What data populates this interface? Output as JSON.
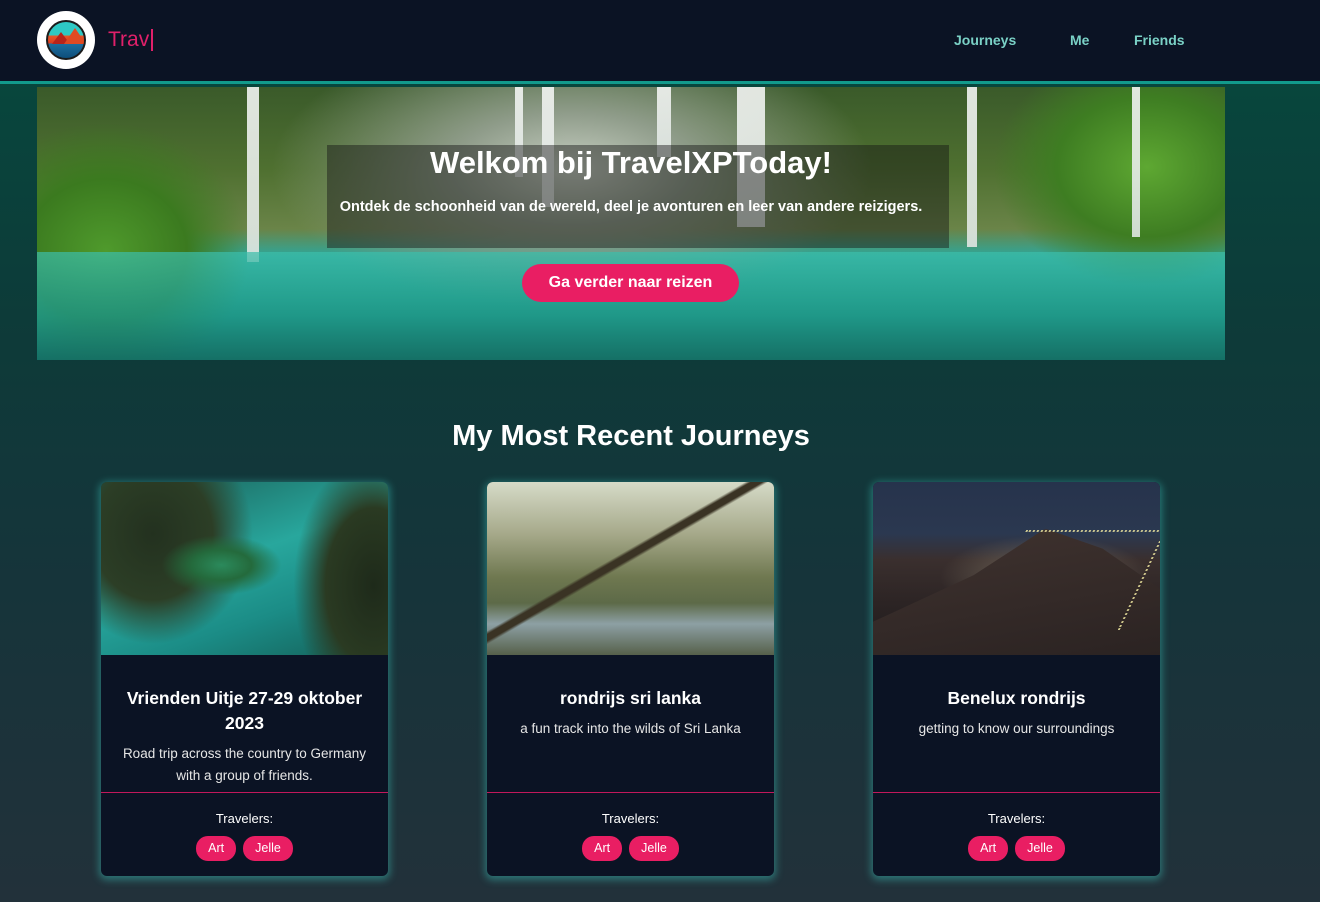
{
  "nav": {
    "brand": "Trav",
    "links": [
      "Journeys",
      "Me",
      "Friends"
    ]
  },
  "hero": {
    "title": "Welkom bij TravelXPToday!",
    "subtitle": "Ontdek de schoonheid van de wereld, deel je avonturen en leer van andere reizigers.",
    "button": "Ga verder naar reizen"
  },
  "section": {
    "title": "My Most Recent Journeys"
  },
  "cards": [
    {
      "title": "Vrienden Uitje 27-29 oktober 2023",
      "description": "Road trip across the country to Germany with a group of friends.",
      "travelers_label": "Travelers:",
      "travelers": [
        "Art",
        "Jelle"
      ]
    },
    {
      "title": "rondrijs sri lanka",
      "description": "a fun track into the wilds of Sri Lanka",
      "travelers_label": "Travelers:",
      "travelers": [
        "Art",
        "Jelle"
      ]
    },
    {
      "title": "Benelux rondrijs",
      "description": "getting to know our surroundings",
      "travelers_label": "Travelers:",
      "travelers": [
        "Art",
        "Jelle"
      ]
    }
  ],
  "colors": {
    "accent": "#e91e63",
    "nav_bg": "#0b1324",
    "nav_link": "#7ad1c6",
    "nav_border": "#129a8c",
    "card_bg": "#0b1324"
  }
}
